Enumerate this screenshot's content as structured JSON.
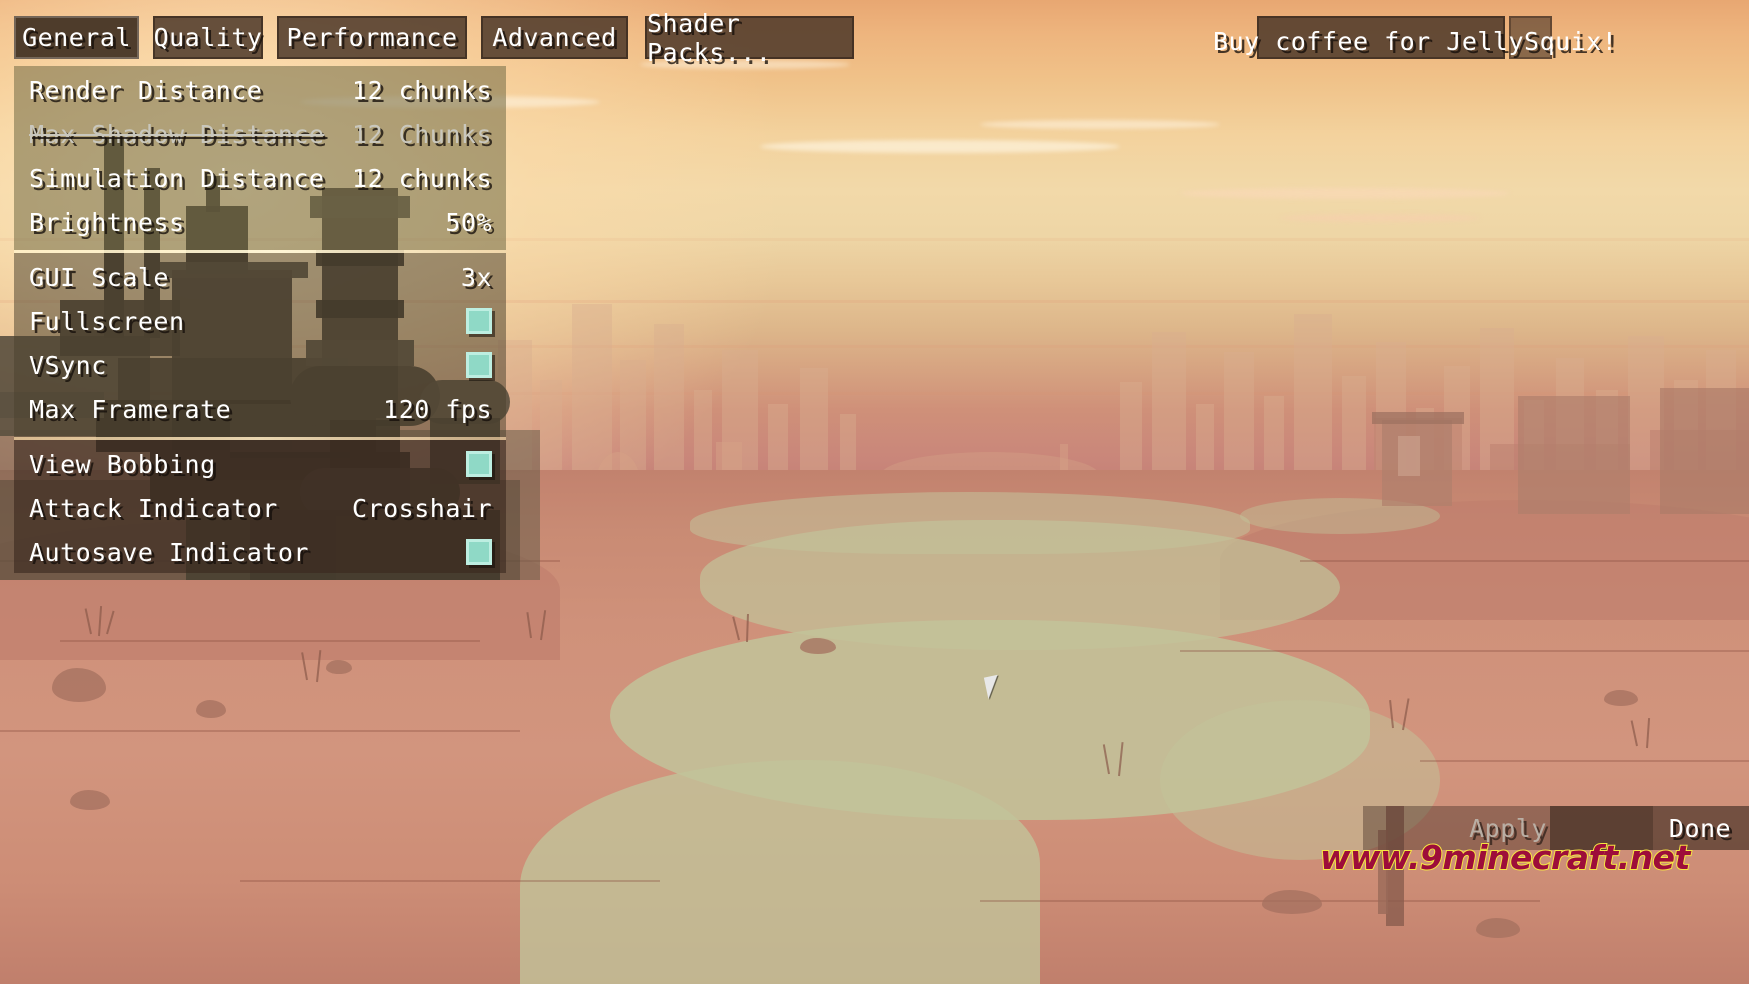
{
  "tabs": [
    {
      "id": "general",
      "label": "General",
      "selected": true
    },
    {
      "id": "quality",
      "label": "Quality",
      "selected": false
    },
    {
      "id": "performance",
      "label": "Performance",
      "selected": false
    },
    {
      "id": "advanced",
      "label": "Advanced",
      "selected": false
    },
    {
      "id": "shaderpacks",
      "label": "Shader Packs...",
      "selected": false
    }
  ],
  "coffee_button": {
    "label": "Buy coffee for JellySquix!"
  },
  "options": {
    "group_1": [
      {
        "label": "Render Distance",
        "value": "12 chunks",
        "type": "value",
        "disabled": false
      },
      {
        "label": "Max Shadow Distance",
        "value": "12 Chunks",
        "type": "value",
        "disabled": true
      },
      {
        "label": "Simulation Distance",
        "value": "12 chunks",
        "type": "value",
        "disabled": false
      },
      {
        "label": "Brightness",
        "value": "50%",
        "type": "value",
        "disabled": false
      }
    ],
    "group_2": [
      {
        "label": "GUI Scale",
        "value": "3x",
        "type": "value",
        "disabled": false
      },
      {
        "label": "Fullscreen",
        "value": "on",
        "type": "checkbox",
        "checked": true
      },
      {
        "label": "VSync",
        "value": "on",
        "type": "checkbox",
        "checked": true
      },
      {
        "label": "Max Framerate",
        "value": "120 fps",
        "type": "value",
        "disabled": false
      }
    ],
    "group_3": [
      {
        "label": "View Bobbing",
        "value": "on",
        "type": "checkbox",
        "checked": true
      },
      {
        "label": "Attack Indicator",
        "value": "Crosshair",
        "type": "value",
        "disabled": false
      },
      {
        "label": "Autosave Indicator",
        "value": "on",
        "type": "checkbox",
        "checked": true
      }
    ]
  },
  "footer": {
    "apply_label": "Apply",
    "done_label": "Done"
  },
  "watermark": {
    "text": "www.9minecraft.net"
  },
  "colors": {
    "checkbox_fill": "#8fd9c6",
    "checkbox_border": "#bdeee1",
    "button_bg": "#463224",
    "text": "#ffffff",
    "disabled_text": "#c9c7bd",
    "watermark_fill": "#9d0d3a",
    "watermark_stroke": "#f5e642"
  }
}
